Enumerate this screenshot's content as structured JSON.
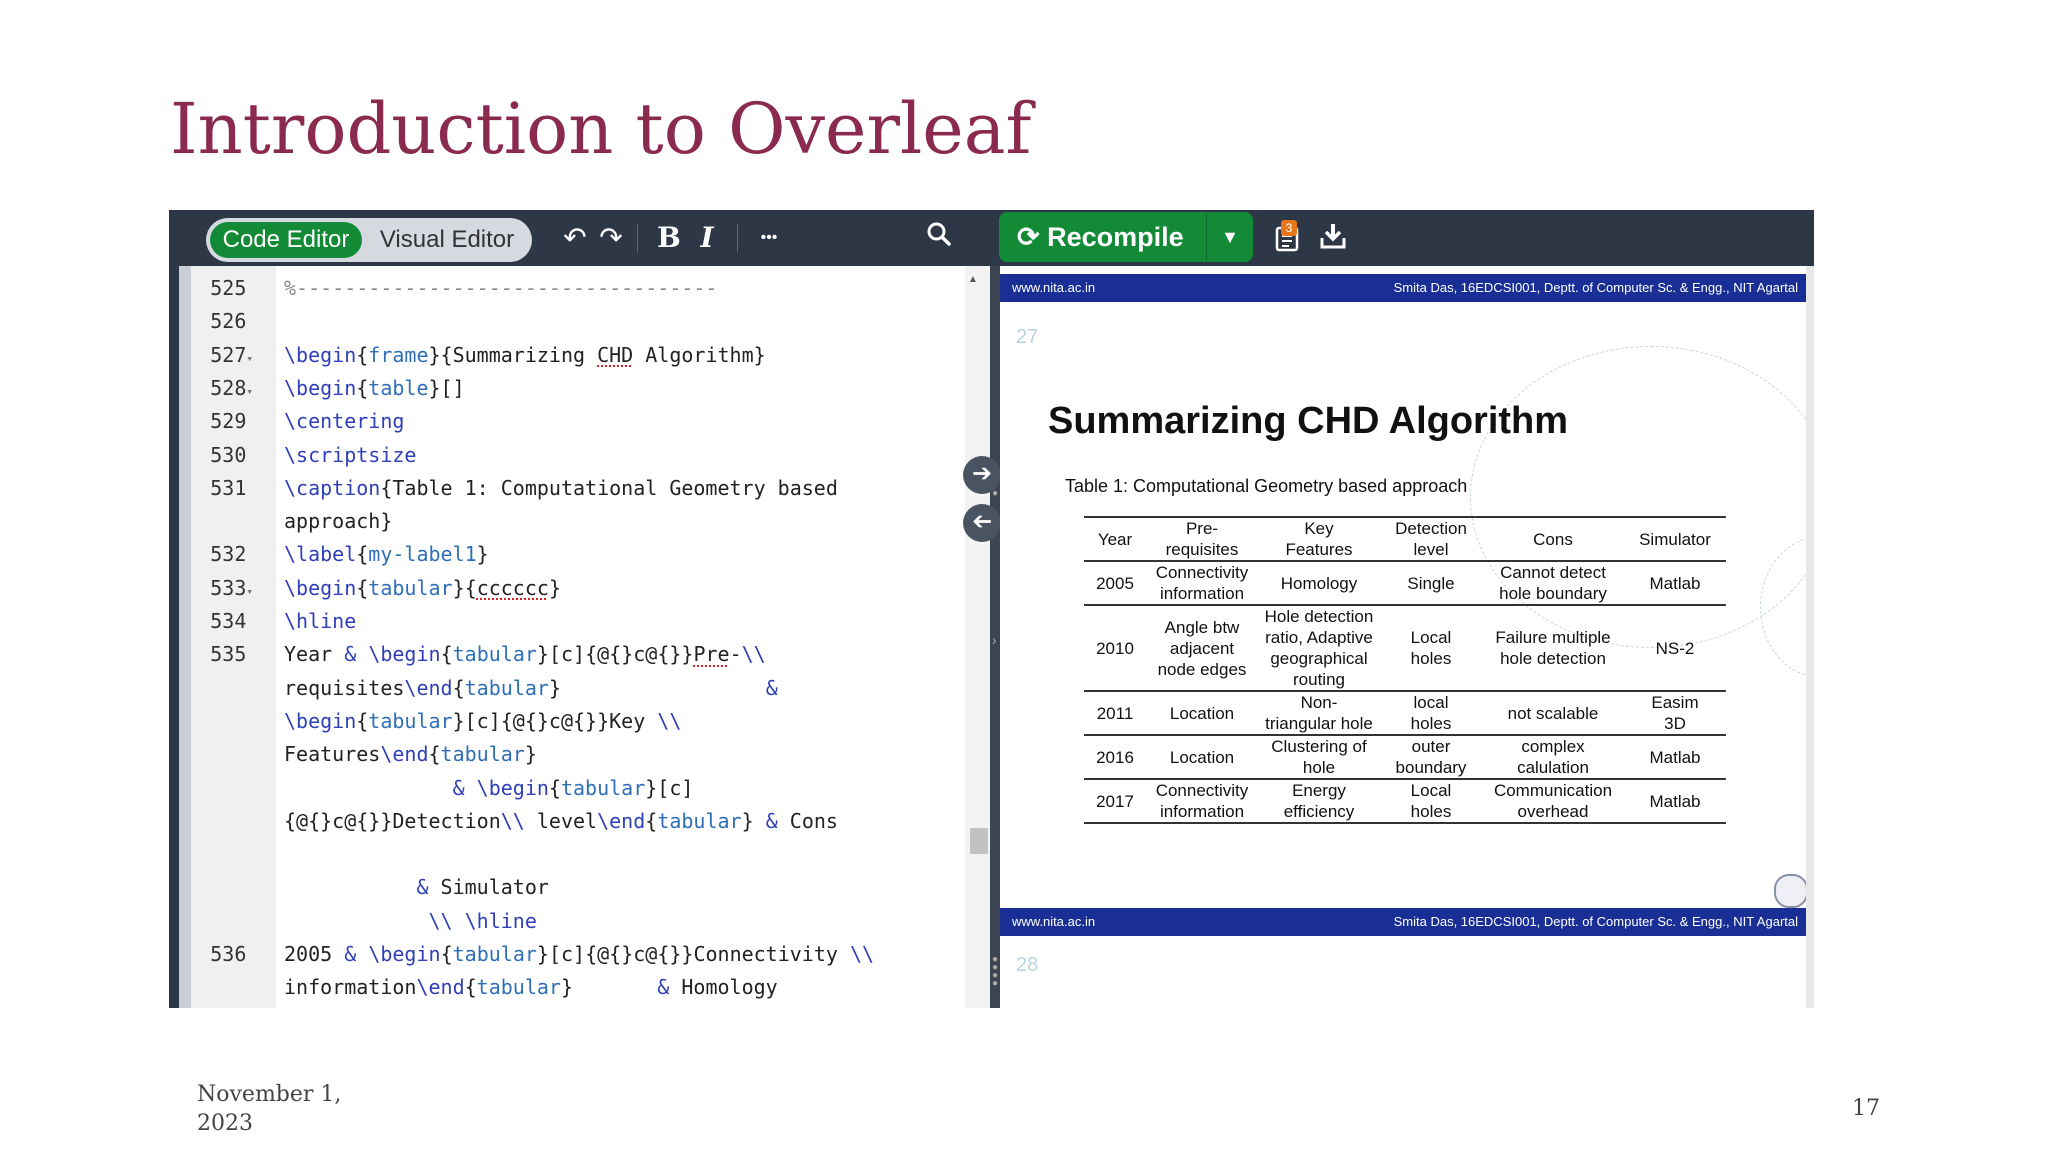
{
  "slide": {
    "title": "Introduction to Overleaf",
    "date_line1": "November 1,",
    "date_line2": "2023",
    "page_number": "17"
  },
  "toolbar": {
    "code_editor": "Code Editor",
    "visual_editor": "Visual Editor",
    "bold": "B",
    "italic": "I",
    "more": "•••",
    "recompile": "Recompile",
    "logs_badge": "3"
  },
  "editor": {
    "lines": [
      {
        "n": "525",
        "fold": false,
        "html": "<span class=\"cm\">%-----------------------------------</span>"
      },
      {
        "n": "526",
        "fold": false,
        "html": ""
      },
      {
        "n": "527",
        "fold": true,
        "html": "<span class=\"kw\">\\begin</span>{<span class=\"arg\">frame</span>}{Summarizing <span class=\"sq\">CHD</span> Algorithm}"
      },
      {
        "n": "528",
        "fold": true,
        "html": "<span class=\"kw\">\\begin</span>{<span class=\"arg\">table</span>}[]"
      },
      {
        "n": "529",
        "fold": false,
        "html": "<span class=\"kw\">\\centering</span>"
      },
      {
        "n": "530",
        "fold": false,
        "html": "<span class=\"kw\">\\scriptsize</span>"
      },
      {
        "n": "531",
        "fold": false,
        "html": "<span class=\"kw\">\\caption</span>{Table 1: Computational Geometry based"
      },
      {
        "n": "",
        "fold": false,
        "html": "approach}"
      },
      {
        "n": "532",
        "fold": false,
        "html": "<span class=\"kw\">\\label</span>{<span class=\"arg\">my-label1</span>}"
      },
      {
        "n": "533",
        "fold": true,
        "html": "<span class=\"kw\">\\begin</span>{<span class=\"arg\">tabular</span>}{<span class=\"sq\">cccccc</span>}"
      },
      {
        "n": "534",
        "fold": false,
        "html": "<span class=\"kw\">\\hline</span>"
      },
      {
        "n": "535",
        "fold": false,
        "html": "Year <span class=\"kw\">&amp;</span> <span class=\"kw\">\\begin</span>{<span class=\"arg\">tabular</span>}[c]{@{}c@{}}<span class=\"sq\">Pre</span>-<span class=\"kw\">\\\\</span>"
      },
      {
        "n": "",
        "fold": false,
        "html": "requisites<span class=\"kw\">\\end</span>{<span class=\"arg\">tabular</span>}                 <span class=\"kw\">&amp;</span>"
      },
      {
        "n": "",
        "fold": false,
        "html": "<span class=\"kw\">\\begin</span>{<span class=\"arg\">tabular</span>}[c]{@{}c@{}}Key <span class=\"kw\">\\\\</span>"
      },
      {
        "n": "",
        "fold": false,
        "html": "Features<span class=\"kw\">\\end</span>{<span class=\"arg\">tabular</span>}"
      },
      {
        "n": "",
        "fold": false,
        "html": "              <span class=\"kw\">&amp;</span> <span class=\"kw\">\\begin</span>{<span class=\"arg\">tabular</span>}[c]"
      },
      {
        "n": "",
        "fold": false,
        "html": "{@{}c@{}}Detection<span class=\"kw\">\\\\</span> level<span class=\"kw\">\\end</span>{<span class=\"arg\">tabular</span>} <span class=\"kw\">&amp;</span> Cons"
      },
      {
        "n": "",
        "fold": false,
        "html": ""
      },
      {
        "n": "",
        "fold": false,
        "html": "           <span class=\"kw\">&amp;</span> Simulator"
      },
      {
        "n": "",
        "fold": false,
        "html": "            <span class=\"kw\">\\\\</span> <span class=\"kw\">\\hline</span>"
      },
      {
        "n": "536",
        "fold": false,
        "html": "2005 <span class=\"kw\">&amp;</span> <span class=\"kw\">\\begin</span>{<span class=\"arg\">tabular</span>}[c]{@{}c@{}}Connectivity <span class=\"kw\">\\\\</span>"
      },
      {
        "n": "",
        "fold": false,
        "html": "information<span class=\"kw\">\\end</span>{<span class=\"arg\">tabular</span>}       <span class=\"kw\">&amp;</span> Homology"
      }
    ]
  },
  "pdf": {
    "bar_left": "www.nita.ac.in",
    "bar_right": "Smita Das, 16EDCSI001, Deptt. of Computer Sc. & Engg., NIT Agartal",
    "page_a": "27",
    "page_b": "28",
    "heading": "Summarizing CHD Algorithm",
    "caption": "Table 1: Computational Geometry based approach",
    "columns": [
      [
        "Year"
      ],
      [
        "Pre-",
        "requisites"
      ],
      [
        "Key",
        "Features"
      ],
      [
        "Detection",
        "level"
      ],
      [
        "Cons"
      ],
      [
        "Simulator"
      ]
    ],
    "rows": [
      [
        [
          "2005"
        ],
        [
          "Connectivity",
          "information"
        ],
        [
          "Homology"
        ],
        [
          "Single"
        ],
        [
          "Cannot detect",
          "hole boundary"
        ],
        [
          "Matlab"
        ]
      ],
      [
        [
          "2010"
        ],
        [
          "Angle btw",
          "adjacent",
          "node edges"
        ],
        [
          "Hole detection",
          "ratio, Adaptive",
          "geographical",
          "routing"
        ],
        [
          "Local",
          "holes"
        ],
        [
          "Failure multiple",
          "hole detection"
        ],
        [
          "NS-2"
        ]
      ],
      [
        [
          "2011"
        ],
        [
          "Location"
        ],
        [
          "Non-",
          "triangular hole"
        ],
        [
          "local",
          "holes"
        ],
        [
          "not scalable"
        ],
        [
          "Easim",
          "3D"
        ]
      ],
      [
        [
          "2016"
        ],
        [
          "Location"
        ],
        [
          "Clustering of",
          "hole"
        ],
        [
          "outer",
          "boundary"
        ],
        [
          "complex",
          "calulation"
        ],
        [
          "Matlab"
        ]
      ],
      [
        [
          "2017"
        ],
        [
          "Connectivity",
          "information"
        ],
        [
          "Energy",
          "efficiency"
        ],
        [
          "Local",
          "holes"
        ],
        [
          "Communication",
          "overhead"
        ],
        [
          "Matlab"
        ]
      ]
    ]
  }
}
